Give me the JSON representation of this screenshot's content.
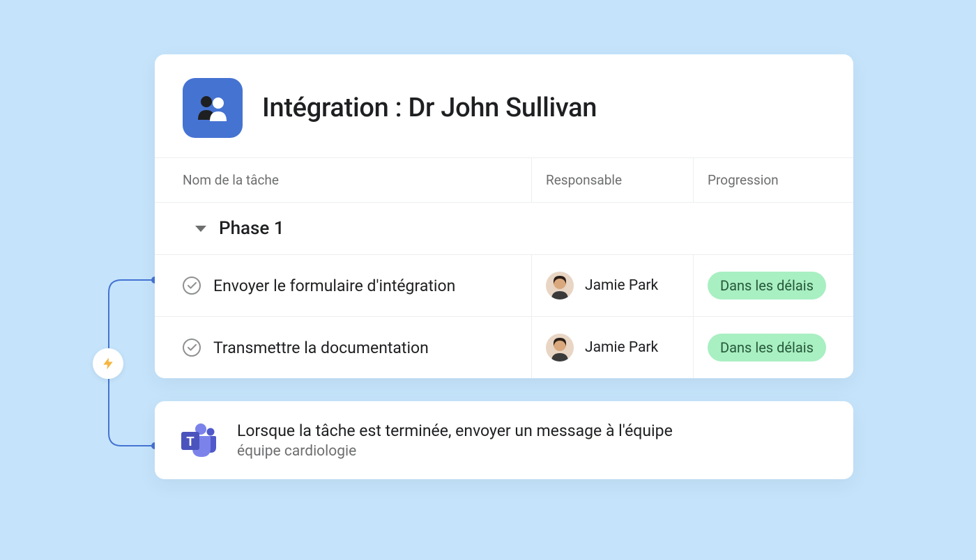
{
  "project": {
    "title": "Intégration : Dr John Sullivan"
  },
  "columns": {
    "task": "Nom de la tâche",
    "responsible": "Responsable",
    "progress": "Progression"
  },
  "section": {
    "name": "Phase 1"
  },
  "tasks": [
    {
      "name": "Envoyer le formulaire d'intégration",
      "assignee": "Jamie Park",
      "status": "Dans les délais"
    },
    {
      "name": "Transmettre la documentation",
      "assignee": "Jamie Park",
      "status": "Dans les délais"
    }
  ],
  "automation": {
    "rule": "Lorsque la tâche est terminée, envoyer un message à l'équipe",
    "target": "équipe cardiologie"
  }
}
